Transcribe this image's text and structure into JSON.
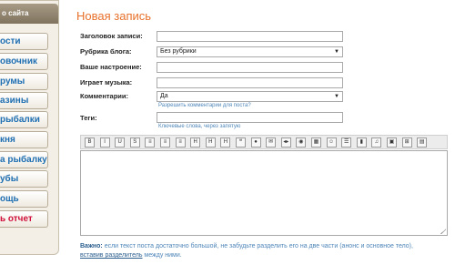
{
  "sidebar": {
    "header": "о сайта",
    "items": [
      {
        "label": "ости",
        "color": "blue"
      },
      {
        "label": "овочник",
        "color": "blue"
      },
      {
        "label": "румы",
        "color": "blue"
      },
      {
        "label": "азины",
        "color": "blue"
      },
      {
        "label": "рыбалки",
        "color": "blue"
      },
      {
        "label": "кня",
        "color": "blue"
      },
      {
        "label": "а рыбалку",
        "color": "blue"
      },
      {
        "label": "убы",
        "color": "blue"
      },
      {
        "label": "ощь",
        "color": "blue"
      },
      {
        "label": "ь отчет",
        "color": "red"
      }
    ]
  },
  "form": {
    "title": "Новая запись",
    "subject_label": "Заголовок записи:",
    "subject_value": "",
    "category_label": "Рубрика блога:",
    "category_value": "Без рубрики",
    "mood_label": "Ваше настроение:",
    "mood_value": "",
    "music_label": "Играет музыка:",
    "music_value": "",
    "comments_label": "Комментарии:",
    "comments_value": "Да",
    "comments_hint": "Разрешить комментарии для поста?",
    "tags_label": "Теги:",
    "tags_value": "",
    "tags_hint": "Ключевые слова, через запятую"
  },
  "toolbar": {
    "buttons": [
      {
        "name": "bold-icon",
        "glyph": "B"
      },
      {
        "name": "italic-icon",
        "glyph": "I"
      },
      {
        "name": "underline-icon",
        "glyph": "U"
      },
      {
        "name": "strike-icon",
        "glyph": "S"
      },
      {
        "name": "align-left-icon",
        "glyph": "≡"
      },
      {
        "name": "align-center-icon",
        "glyph": "≡"
      },
      {
        "name": "align-right-icon",
        "glyph": "≡"
      },
      {
        "name": "h1-icon",
        "glyph": "H"
      },
      {
        "name": "h2-icon",
        "glyph": "H"
      },
      {
        "name": "h3-icon",
        "glyph": "H"
      },
      {
        "name": "quote-icon",
        "glyph": "❝"
      },
      {
        "name": "link-icon",
        "glyph": "●"
      },
      {
        "name": "email-icon",
        "glyph": "✉"
      },
      {
        "name": "code-icon",
        "glyph": "◂▸"
      },
      {
        "name": "spoiler-icon",
        "glyph": "◉"
      },
      {
        "name": "image-icon",
        "glyph": "▦"
      },
      {
        "name": "smile-icon",
        "glyph": "☺"
      },
      {
        "name": "list-icon",
        "glyph": "☰"
      },
      {
        "name": "video-icon",
        "glyph": "▮"
      },
      {
        "name": "music-icon",
        "glyph": "♫"
      },
      {
        "name": "photo-icon",
        "glyph": "▣"
      },
      {
        "name": "table-icon",
        "glyph": "⊞"
      },
      {
        "name": "cut-icon",
        "glyph": "▤"
      }
    ]
  },
  "editor": {
    "value": ""
  },
  "note": {
    "bold": "Важно:",
    "text": " если текст поста достаточно большой, не забудьте разделить его на две части (анонс и основное тело),",
    "link": "вставив разделитель",
    "tail": " между ними."
  }
}
